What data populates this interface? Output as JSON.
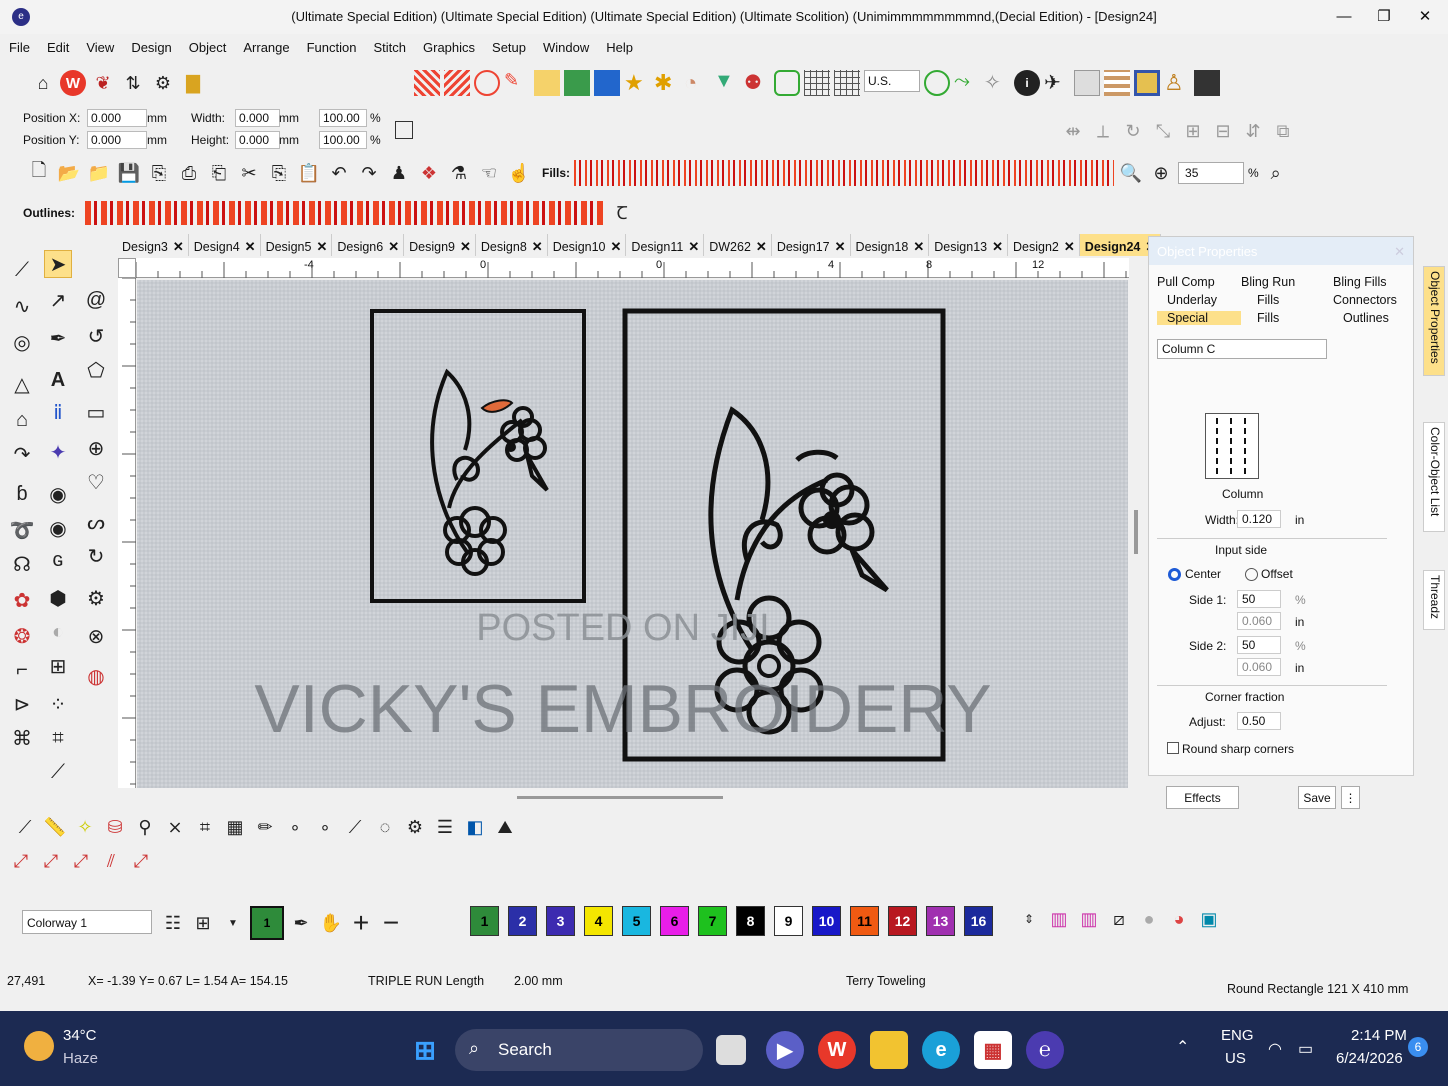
{
  "window": {
    "title": "(Ultimate Special Edition) (Ultimate Special Edition) (Ultimate Special Edition) (Ultimate Scolition) (Unimimmmmmmmmnd,(Decial Edition) - [Design24]",
    "minimize": "—",
    "restore": "❐",
    "close": "✕"
  },
  "menu": [
    "File",
    "Edit",
    "View",
    "Design",
    "Object",
    "Arrange",
    "Function",
    "Stitch",
    "Graphics",
    "Setup",
    "Window",
    "Help"
  ],
  "toolbar1": {
    "units": "U.S."
  },
  "position": {
    "x_label": "Position X:",
    "x_val": "0.000",
    "y_label": "Position Y:",
    "y_val": "0.000",
    "unit": "mm",
    "w_label": "Width:",
    "w_val": "0.000",
    "h_label": "Height:",
    "h_val": "0.000",
    "w_pct": "100.00",
    "h_pct": "100.00",
    "pct": "%"
  },
  "toolbar2": {
    "fills_label": "Fills:",
    "zoom": "35",
    "zoom_unit": "%"
  },
  "outlines_label": "Outlines:",
  "tabs": [
    "Design3",
    "Design4",
    "Design5",
    "Design6",
    "Design9",
    "Design8",
    "Design10",
    "Design11",
    "DW262",
    "Design17",
    "Design18",
    "Design13",
    "Design2",
    "Design24"
  ],
  "ruler": [
    "-4",
    "0",
    "0",
    "4",
    "8",
    "12"
  ],
  "canvas": {
    "watermark1": "POSTED ON JIJI",
    "watermark2": "VICKY'S EMBROIDERY"
  },
  "panel": {
    "title": "Object Properties",
    "tabs": [
      "Pull Comp",
      "Bling Run",
      "Bling Fills",
      "Underlay",
      "Fills",
      "Connectors",
      "Special",
      "Fills",
      "Outlines"
    ],
    "type": "Column C",
    "preview_label": "Column",
    "width_label": "Width:",
    "width_val": "0.120",
    "width_unit": "in",
    "input_side": "Input side",
    "center": "Center",
    "offset": "Offset",
    "side1": "Side 1:",
    "side1_pct": "50",
    "side1_in": "0.060",
    "side2": "Side 2:",
    "side2_pct": "50",
    "side2_in": "0.060",
    "pct": "%",
    "in": "in",
    "corner": "Corner fraction",
    "adjust": "Adjust:",
    "adjust_val": "0.50",
    "round": "Round sharp corners",
    "effects": "Effects",
    "save": "Save"
  },
  "sidetabs": [
    "Object Properties",
    "Color-Object List",
    "Threadz"
  ],
  "colorway": {
    "name": "Colorway 1",
    "current": "1"
  },
  "palette": [
    {
      "n": "1",
      "bg": "#2e8b3a",
      "fg": "#000"
    },
    {
      "n": "2",
      "bg": "#2b2fa8",
      "fg": "#fff"
    },
    {
      "n": "3",
      "bg": "#3c2bb0",
      "fg": "#fff"
    },
    {
      "n": "4",
      "bg": "#f4e600",
      "fg": "#000"
    },
    {
      "n": "5",
      "bg": "#19b7e0",
      "fg": "#000"
    },
    {
      "n": "6",
      "bg": "#e81ee8",
      "fg": "#000"
    },
    {
      "n": "7",
      "bg": "#1ec11e",
      "fg": "#000"
    },
    {
      "n": "8",
      "bg": "#000000",
      "fg": "#fff"
    },
    {
      "n": "9",
      "bg": "#ffffff",
      "fg": "#000"
    },
    {
      "n": "10",
      "bg": "#1818c8",
      "fg": "#fff"
    },
    {
      "n": "11",
      "bg": "#f05a12",
      "fg": "#000"
    },
    {
      "n": "12",
      "bg": "#b81820",
      "fg": "#fff"
    },
    {
      "n": "13",
      "bg": "#a030b0",
      "fg": "#fff"
    },
    {
      "n": "16",
      "bg": "#1c2a9c",
      "fg": "#fff"
    }
  ],
  "status": {
    "count": "27,491",
    "coords": "X= -1.39 Y= 0.67 L= 1.54 A= 154.15",
    "stitch": "TRIPLE RUN Length",
    "length": "2.00 mm",
    "fabric": "Terry Toweling",
    "object": "Round Rectangle 121 X 410 mm"
  },
  "taskbar": {
    "temp": "34°C",
    "weather": "Haze",
    "search": "Search",
    "lang1": "ENG",
    "lang2": "US",
    "time": "2:14 PM",
    "date": "6/24/2026",
    "badge": "6"
  }
}
